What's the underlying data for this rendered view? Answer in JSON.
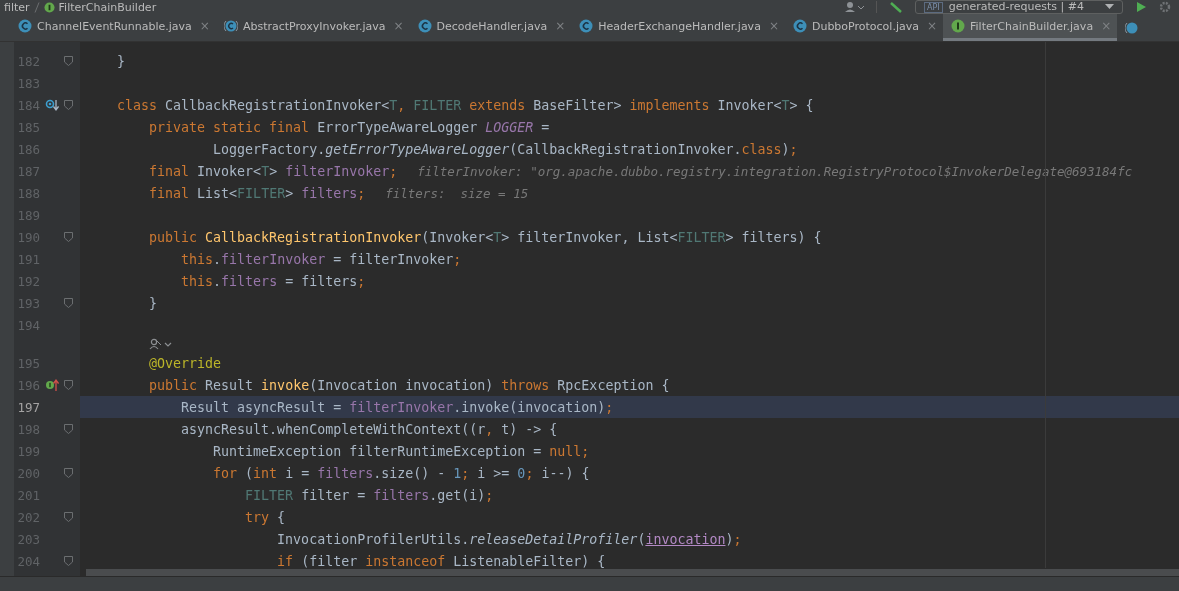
{
  "breadcrumbs": [
    "filter",
    "FilterChainBuilder"
  ],
  "run_config": {
    "badge": "API",
    "label": "generated-requests | #4"
  },
  "tabs": [
    {
      "label": "ChannelEventRunnable.java",
      "kind": "class",
      "close": "×",
      "selected": false
    },
    {
      "label": "AbstractProxyInvoker.java",
      "kind": "abstract",
      "close": "×",
      "selected": false
    },
    {
      "label": "DecodeHandler.java",
      "kind": "class",
      "close": "×",
      "selected": false
    },
    {
      "label": "HeaderExchangeHandler.java",
      "kind": "class",
      "close": "×",
      "selected": false
    },
    {
      "label": "DubboProtocol.java",
      "kind": "class",
      "close": "×",
      "selected": false
    },
    {
      "label": "FilterChainBuilder.java",
      "kind": "interface",
      "close": "×",
      "selected": true
    }
  ],
  "lines": [
    {
      "kind": "code",
      "number": "182",
      "fold": true,
      "tokens": [
        {
          "text": "}",
          "kind": "p"
        }
      ]
    },
    {
      "kind": "code",
      "number": "183"
    },
    {
      "kind": "code",
      "number": "184",
      "fold": true,
      "implemented": true,
      "tokens": [
        {
          "text": "class",
          "kind": "kw"
        },
        {
          "text": " CallbackRegistrationInvoker<",
          "kind": "p"
        },
        {
          "text": "T",
          "kind": "tp"
        },
        {
          "text": ",",
          "kind": "kw"
        },
        {
          "text": " FILTER",
          "kind": "tp"
        },
        {
          "text": " extends",
          "kind": "kw"
        },
        {
          "text": " BaseFilter> ",
          "kind": "p"
        },
        {
          "text": "implements",
          "kind": "kw"
        },
        {
          "text": " Invoker<",
          "kind": "p"
        },
        {
          "text": "T",
          "kind": "tp"
        },
        {
          "text": "> {",
          "kind": "p"
        }
      ]
    },
    {
      "kind": "code",
      "number": "185",
      "tokens": [
        {
          "text": "    private static final",
          "kind": "kw"
        },
        {
          "text": " ErrorTypeAwareLogger ",
          "kind": "p"
        },
        {
          "text": "LOGGER",
          "kind": "sfld"
        },
        {
          "text": " =",
          "kind": "p"
        }
      ]
    },
    {
      "kind": "code",
      "number": "186",
      "tokens": [
        {
          "text": "            LoggerFactory.",
          "kind": "p"
        },
        {
          "text": "getErrorTypeAwareLogger",
          "kind": "ital"
        },
        {
          "text": "(CallbackRegistrationInvoker.",
          "kind": "p"
        },
        {
          "text": "class",
          "kind": "kw"
        },
        {
          "text": ")",
          "kind": "p"
        },
        {
          "text": ";",
          "kind": "kw"
        }
      ]
    },
    {
      "kind": "code",
      "number": "187",
      "hint": "filterInvoker: \"org.apache.dubbo.registry.integration.RegistryProtocol$InvokerDelegate@693184fc",
      "tokens": [
        {
          "text": "    final",
          "kind": "kw"
        },
        {
          "text": " Invoker<",
          "kind": "p"
        },
        {
          "text": "T",
          "kind": "tp"
        },
        {
          "text": "> ",
          "kind": "p"
        },
        {
          "text": "filterInvoker",
          "kind": "fld"
        },
        {
          "text": ";",
          "kind": "kw"
        }
      ]
    },
    {
      "kind": "code",
      "number": "188",
      "hint": "filters:  size = 15",
      "tokens": [
        {
          "text": "    final",
          "kind": "kw"
        },
        {
          "text": " List<",
          "kind": "p"
        },
        {
          "text": "FILTER",
          "kind": "tp"
        },
        {
          "text": "> ",
          "kind": "p"
        },
        {
          "text": "filters",
          "kind": "fld"
        },
        {
          "text": ";",
          "kind": "kw"
        }
      ]
    },
    {
      "kind": "code",
      "number": "189"
    },
    {
      "kind": "code",
      "number": "190",
      "fold": true,
      "tokens": [
        {
          "text": "    public",
          "kind": "kw"
        },
        {
          "text": " CallbackRegistrationInvoker",
          "kind": "decl"
        },
        {
          "text": "(Invoker<",
          "kind": "p"
        },
        {
          "text": "T",
          "kind": "tp"
        },
        {
          "text": "> filterInvoker, List<",
          "kind": "p"
        },
        {
          "text": "FILTER",
          "kind": "tp"
        },
        {
          "text": "> filters) {",
          "kind": "p"
        }
      ]
    },
    {
      "kind": "code",
      "number": "191",
      "tokens": [
        {
          "text": "        this",
          "kind": "kw"
        },
        {
          "text": ".",
          "kind": "p"
        },
        {
          "text": "filterInvoker",
          "kind": "fld"
        },
        {
          "text": " = filterInvoker",
          "kind": "p"
        },
        {
          "text": ";",
          "kind": "kw"
        }
      ]
    },
    {
      "kind": "code",
      "number": "192",
      "tokens": [
        {
          "text": "        this",
          "kind": "kw"
        },
        {
          "text": ".",
          "kind": "p"
        },
        {
          "text": "filters",
          "kind": "fld"
        },
        {
          "text": " = filters",
          "kind": "p"
        },
        {
          "text": ";",
          "kind": "kw"
        }
      ]
    },
    {
      "kind": "code",
      "number": "193",
      "fold": true,
      "tokens": [
        {
          "text": "    }",
          "kind": "p"
        }
      ]
    },
    {
      "kind": "code",
      "number": "194"
    },
    {
      "kind": "vision"
    },
    {
      "kind": "code",
      "number": "195",
      "tokens": [
        {
          "text": "    @Override",
          "kind": "ann"
        }
      ]
    },
    {
      "kind": "code",
      "number": "196",
      "fold": true,
      "implementing": true,
      "tokens": [
        {
          "text": "    public",
          "kind": "kw"
        },
        {
          "text": " Result ",
          "kind": "p"
        },
        {
          "text": "invoke",
          "kind": "decl"
        },
        {
          "text": "(Invocation invocation) ",
          "kind": "p"
        },
        {
          "text": "throws",
          "kind": "kw"
        },
        {
          "text": " RpcException {",
          "kind": "p"
        }
      ]
    },
    {
      "kind": "code",
      "number": "197",
      "current": true,
      "tokens": [
        {
          "text": "        Result asyncResult = ",
          "kind": "p"
        },
        {
          "text": "filterInvoker",
          "kind": "fld"
        },
        {
          "text": ".invoke(invocation)",
          "kind": "p"
        },
        {
          "text": ";",
          "kind": "kw"
        }
      ]
    },
    {
      "kind": "code",
      "number": "198",
      "fold": true,
      "tokens": [
        {
          "text": "        asyncResult.whenCompleteWithContext((r",
          "kind": "p"
        },
        {
          "text": ",",
          "kind": "kw"
        },
        {
          "text": " t) -> {",
          "kind": "p"
        }
      ]
    },
    {
      "kind": "code",
      "number": "199",
      "tokens": [
        {
          "text": "            RuntimeException filterRuntimeException = ",
          "kind": "p"
        },
        {
          "text": "null",
          "kind": "kw"
        },
        {
          "text": ";",
          "kind": "kw"
        }
      ]
    },
    {
      "kind": "code",
      "number": "200",
      "fold": true,
      "tokens": [
        {
          "text": "            for",
          "kind": "kw"
        },
        {
          "text": " (",
          "kind": "p"
        },
        {
          "text": "int",
          "kind": "kw"
        },
        {
          "text": " i = ",
          "kind": "p"
        },
        {
          "text": "filters",
          "kind": "fld"
        },
        {
          "text": ".size() - ",
          "kind": "p"
        },
        {
          "text": "1",
          "kind": "num"
        },
        {
          "text": ";",
          "kind": "kw"
        },
        {
          "text": " i >= ",
          "kind": "p"
        },
        {
          "text": "0",
          "kind": "num"
        },
        {
          "text": ";",
          "kind": "kw"
        },
        {
          "text": " i--) {",
          "kind": "p"
        }
      ]
    },
    {
      "kind": "code",
      "number": "201",
      "tokens": [
        {
          "text": "                FILTER",
          "kind": "tp"
        },
        {
          "text": " filter = ",
          "kind": "p"
        },
        {
          "text": "filters",
          "kind": "fld"
        },
        {
          "text": ".get(i)",
          "kind": "p"
        },
        {
          "text": ";",
          "kind": "kw"
        }
      ]
    },
    {
      "kind": "code",
      "number": "202",
      "fold": true,
      "tokens": [
        {
          "text": "                try",
          "kind": "kw"
        },
        {
          "text": " {",
          "kind": "p"
        }
      ]
    },
    {
      "kind": "code",
      "number": "203",
      "tokens": [
        {
          "text": "                    InvocationProfilerUtils.",
          "kind": "p"
        },
        {
          "text": "releaseDetailProfiler",
          "kind": "ital"
        },
        {
          "text": "(",
          "kind": "p"
        },
        {
          "text": "invocation",
          "kind": "param"
        },
        {
          "text": ")",
          "kind": "p"
        },
        {
          "text": ";",
          "kind": "kw"
        }
      ]
    },
    {
      "kind": "code",
      "number": "204",
      "fold": true,
      "tokens": [
        {
          "text": "                    if",
          "kind": "kw"
        },
        {
          "text": " (filter ",
          "kind": "p"
        },
        {
          "text": "instanceof",
          "kind": "kw"
        },
        {
          "text": " ListenableFilter) {",
          "kind": "p"
        }
      ]
    }
  ]
}
